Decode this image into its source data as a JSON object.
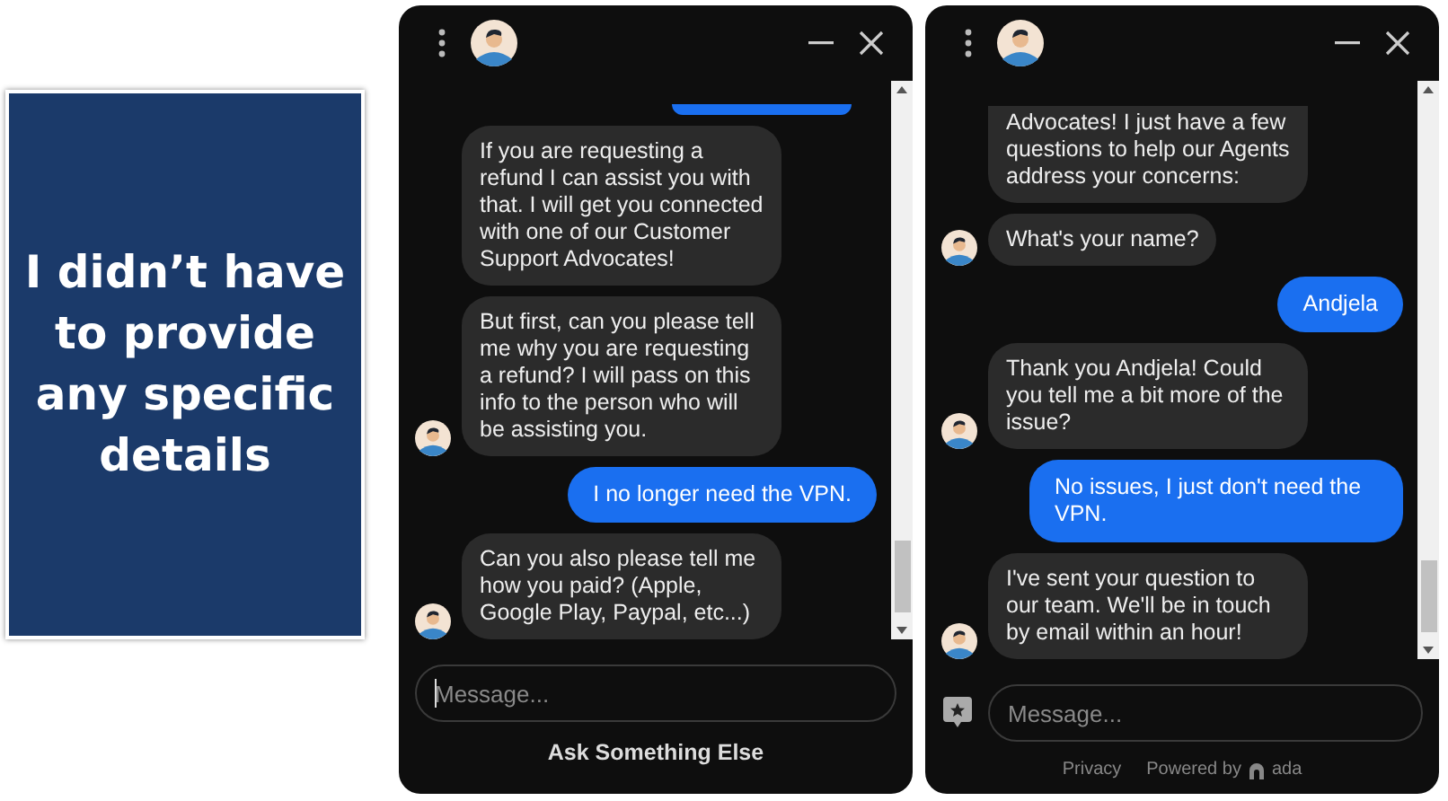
{
  "caption": {
    "text": "I didn’t have to provide any specific details"
  },
  "windows": [
    {
      "messages": [
        {
          "kind": "user",
          "cropped": true
        },
        {
          "kind": "bot",
          "text": "If you are requesting a refund I can assist you with that. I will get you connected with one of our Customer Support Advocates!",
          "avatar": false
        },
        {
          "kind": "bot",
          "text": "But first, can you please tell me why you are requesting a refund? I will pass on this info to the person who will be assisting you.",
          "avatar": true
        },
        {
          "kind": "user",
          "text": "I no longer need the VPN."
        },
        {
          "kind": "bot",
          "text": "Can you also please tell me how you paid? (Apple, Google Play, Paypal, etc...)",
          "avatar": true
        }
      ],
      "input": {
        "placeholder": "Message...",
        "focused": true
      },
      "action_button": "Ask Something Else"
    },
    {
      "messages": [
        {
          "kind": "bot",
          "text": "Advocates! I just have a few questions to help our Agents address your concerns:",
          "avatar": false,
          "cropped": true
        },
        {
          "kind": "bot",
          "text": "What's your name?",
          "avatar": true
        },
        {
          "kind": "user",
          "text": "Andjela"
        },
        {
          "kind": "bot",
          "text": "Thank you Andjela! Could you tell me a bit more of the issue?",
          "avatar": true
        },
        {
          "kind": "user",
          "text": "No issues, I just don't need the VPN."
        },
        {
          "kind": "bot",
          "text": "I've sent your question to our team. We'll be in touch by email within an hour!",
          "avatar": true
        }
      ],
      "input": {
        "placeholder": "Message...",
        "focused": false
      },
      "footer": {
        "privacy": "Privacy",
        "powered_by": "Powered by",
        "brand": "ada"
      }
    }
  ]
}
